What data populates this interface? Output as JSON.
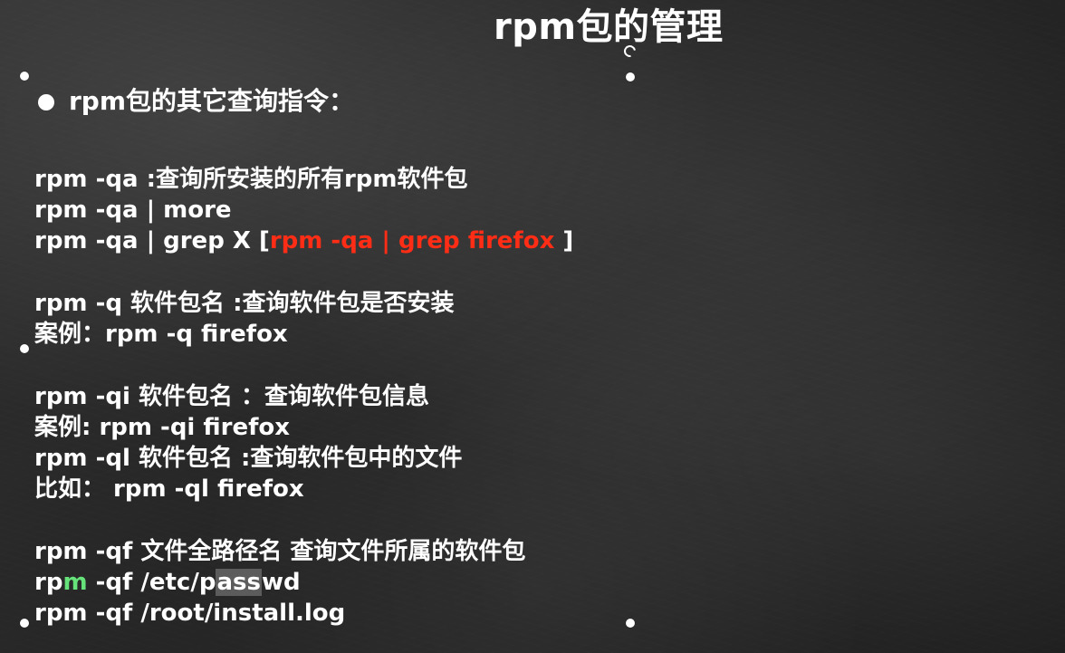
{
  "slide": {
    "title": "rpm包的管理",
    "heading": "rpm包的其它查询指令：",
    "groups": [
      {
        "lines": [
          {
            "text": "rpm -qa :查询所安装的所有rpm软件包"
          },
          {
            "text": "rpm -qa | more"
          },
          {
            "prefix": "rpm -qa | grep X [",
            "highlight": "rpm -qa | grep firefox",
            "suffix": " ]"
          }
        ]
      },
      {
        "lines": [
          {
            "text": "rpm -q 软件包名 :查询软件包是否安装"
          },
          {
            "text": "案例：rpm -q firefox"
          }
        ]
      },
      {
        "lines": [
          {
            "text": "rpm -qi 软件包名  ：查询软件包信息"
          },
          {
            "text": "案例: rpm -qi firefox"
          },
          {
            "text": "rpm -ql 软件包名 :查询软件包中的文件"
          },
          {
            "text": "比如：  rpm -ql firefox"
          }
        ]
      },
      {
        "lines": [
          {
            "text": "rpm -qf 文件全路径名 查询文件所属的软件包"
          },
          {
            "part1": "rp",
            "part2": "m",
            "part3": " -qf /etc/p",
            "part4": "ass",
            "part5": "wd"
          },
          {
            "text": "rpm -qf /root/install.log"
          }
        ]
      }
    ]
  },
  "colors": {
    "background": "#262626",
    "text": "#ffffff",
    "highlight_red": "#ff2d16",
    "highlight_green": "#66e27a",
    "selection_box": "#5c5c5c"
  },
  "icons": {
    "bullet": "bullet-icon",
    "selection_handle": "selection-handle-icon",
    "rotate_handle": "rotate-handle-icon"
  }
}
